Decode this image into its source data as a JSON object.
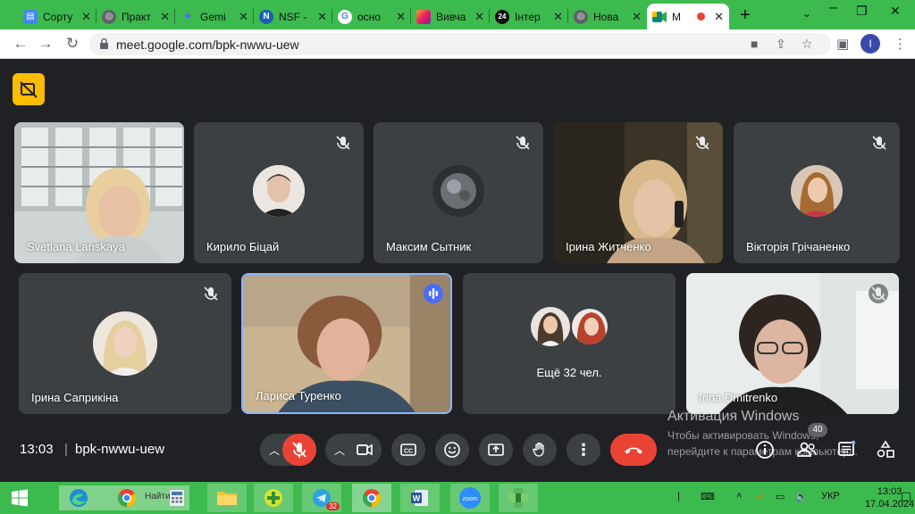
{
  "browser": {
    "tabs": [
      {
        "label": "Сорту",
        "favicon": "doc-icon",
        "color": "#4285f4"
      },
      {
        "label": "Практ",
        "favicon": "globe-icon",
        "color": "#5f6368"
      },
      {
        "label": "Gemi",
        "favicon": "gemini-icon",
        "color": "#4a6cf7"
      },
      {
        "label": "NSF -",
        "favicon": "nsf-icon",
        "color": "#1a5fb4"
      },
      {
        "label": "осно",
        "favicon": "google-icon",
        "color": "#ea4335"
      },
      {
        "label": "Вивча",
        "favicon": "gradient-icon",
        "color": "#e44d8a"
      },
      {
        "label": "Інтер",
        "favicon": "24-icon",
        "color": "#111111"
      },
      {
        "label": "Нова",
        "favicon": "globe-icon",
        "color": "#5f6368"
      },
      {
        "label": "M",
        "favicon": "meet-icon",
        "color": "#00897b"
      }
    ],
    "url": "meet.google.com/bpk-nwwu-uew",
    "profile_initial": "I"
  },
  "meeting": {
    "time": "13:03",
    "separator": "|",
    "code": "bpk-nwwu-uew",
    "participants": [
      {
        "name": "Svetlana Lanskaya",
        "type": "video",
        "muted": false
      },
      {
        "name": "Кирило Біцай",
        "type": "avatar",
        "muted": true
      },
      {
        "name": "Максим Сытник",
        "type": "avatar",
        "muted": true
      },
      {
        "name": "Ірина Житченко",
        "type": "video",
        "muted": true
      },
      {
        "name": "Вікторія Грічаненко",
        "type": "avatar",
        "muted": true
      },
      {
        "name": "Ірина Саприкіна",
        "type": "avatar",
        "muted": true
      },
      {
        "name": "Лариса Туренко",
        "type": "video",
        "muted": false,
        "speaking": true
      },
      {
        "name": "Ещё 32 чел.",
        "type": "group",
        "muted": false
      },
      {
        "name": "Irina Dmitrenko",
        "type": "video",
        "muted": true
      }
    ],
    "people_count": "40",
    "accent_red": "#ea4335",
    "accent_yellow": "#fbbc04",
    "speaking_blue": "#4a6cf7"
  },
  "watermark": {
    "line1": "Активация Windows",
    "line2": "Чтобы активировать Windows,",
    "line3": "перейдите к параметрам компьютера."
  },
  "taskbar": {
    "search_hint": "Найти",
    "telegram_badge": "32",
    "language": "УКР",
    "time": "13:03",
    "date": "17.04.2024"
  }
}
